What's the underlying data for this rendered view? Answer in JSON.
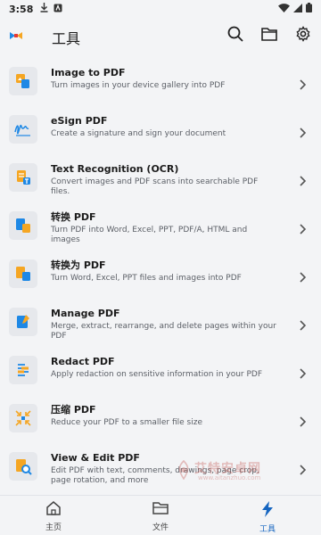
{
  "status_bar": {
    "time": "3:58"
  },
  "app_bar": {
    "title": "工具"
  },
  "tools": [
    {
      "title": "Image to PDF",
      "desc": "Turn images in your device gallery into PDF"
    },
    {
      "title": "eSign PDF",
      "desc": "Create a signature and sign your document"
    },
    {
      "title": "Text Recognition (OCR)",
      "desc": "Convert images and PDF scans into searchable PDF files."
    },
    {
      "title": "转换 PDF",
      "desc": "Turn PDF into Word, Excel, PPT, PDF/A, HTML and images"
    },
    {
      "title": "转换为 PDF",
      "desc": "Turn Word, Excel, PPT files and images into PDF"
    },
    {
      "title": "Manage PDF",
      "desc": "Merge, extract, rearrange, and delete pages within your PDF"
    },
    {
      "title": "Redact PDF",
      "desc": "Apply redaction on sensitive information in your PDF"
    },
    {
      "title": "压缩 PDF",
      "desc": "Reduce your PDF to a smaller file size"
    },
    {
      "title": "View & Edit PDF",
      "desc": "Edit PDF with text, comments, drawings, page crop, page rotation, and more"
    }
  ],
  "bottom_nav": {
    "home": "主页",
    "files": "文件",
    "tools": "工具"
  },
  "watermark": {
    "text": "艾特安卓网",
    "url": "www.aitanzhuo.com"
  },
  "colors": {
    "accent": "#1565c0",
    "orange": "#f5a623",
    "blue": "#1e88e5"
  }
}
